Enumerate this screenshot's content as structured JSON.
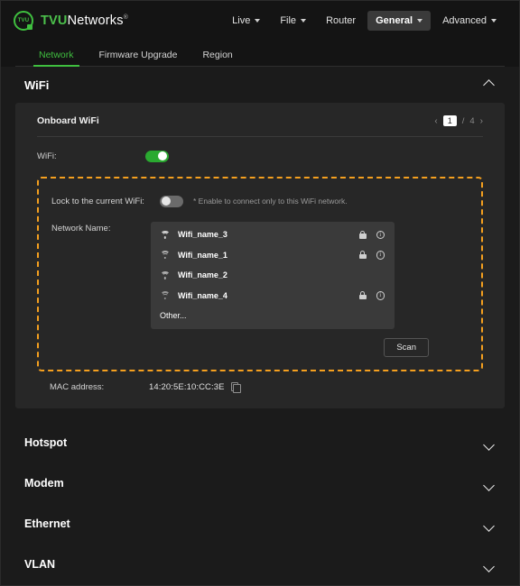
{
  "brand": {
    "mark_text": "TVU",
    "name_green": "TVU",
    "name_white": "Networks",
    "registered": "®"
  },
  "topnav": {
    "items": [
      {
        "label": "Live",
        "has_caret": true,
        "active": false
      },
      {
        "label": "File",
        "has_caret": true,
        "active": false
      },
      {
        "label": "Router",
        "has_caret": false,
        "active": false
      },
      {
        "label": "General",
        "has_caret": true,
        "active": true
      },
      {
        "label": "Advanced",
        "has_caret": true,
        "active": false
      }
    ]
  },
  "subtabs": {
    "items": [
      {
        "label": "Network",
        "active": true
      },
      {
        "label": "Firmware Upgrade",
        "active": false
      },
      {
        "label": "Region",
        "active": false
      }
    ]
  },
  "wifi_section": {
    "title": "WiFi",
    "collapse_icon": "chevron-up-icon",
    "card": {
      "title": "Onboard WiFi",
      "pager": {
        "prev": "‹",
        "current": "1",
        "separator": "/",
        "total": "4",
        "next": "›"
      },
      "wifi_row": {
        "label": "WiFi:",
        "toggle_state": "on"
      },
      "lock_row": {
        "label": "Lock to the current WiFi:",
        "toggle_state": "off",
        "hint": "* Enable to connect only to this WiFi network."
      },
      "network_name": {
        "label": "Network Name:",
        "items": [
          {
            "ssid": "Wifi_name_3",
            "signal": 3,
            "locked": true,
            "info": true
          },
          {
            "ssid": "Wifi_name_1",
            "signal": 2,
            "locked": true,
            "info": true
          },
          {
            "ssid": "Wifi_name_2",
            "signal": 2,
            "locked": false,
            "info": false
          },
          {
            "ssid": "Wifi_name_4",
            "signal": 1,
            "locked": true,
            "info": true
          }
        ],
        "other_label": "Other..."
      },
      "scan_button": "Scan",
      "mac": {
        "label": "MAC address:",
        "value": "14:20:5E:10:CC:3E",
        "copy_icon": "copy-icon"
      }
    }
  },
  "accordions": [
    {
      "title": "Hotspot",
      "icon": "chevron-down-icon"
    },
    {
      "title": "Modem",
      "icon": "chevron-down-icon"
    },
    {
      "title": "Ethernet",
      "icon": "chevron-down-icon"
    },
    {
      "title": "VLAN",
      "icon": "chevron-down-icon"
    }
  ],
  "colors": {
    "accent_green": "#3fbf3f",
    "toggle_on": "#2aa930",
    "highlight_orange": "#f5a01f",
    "page_bg": "#1b1b1b",
    "card_bg": "#272727",
    "panel_bg": "#3a3a3a"
  }
}
